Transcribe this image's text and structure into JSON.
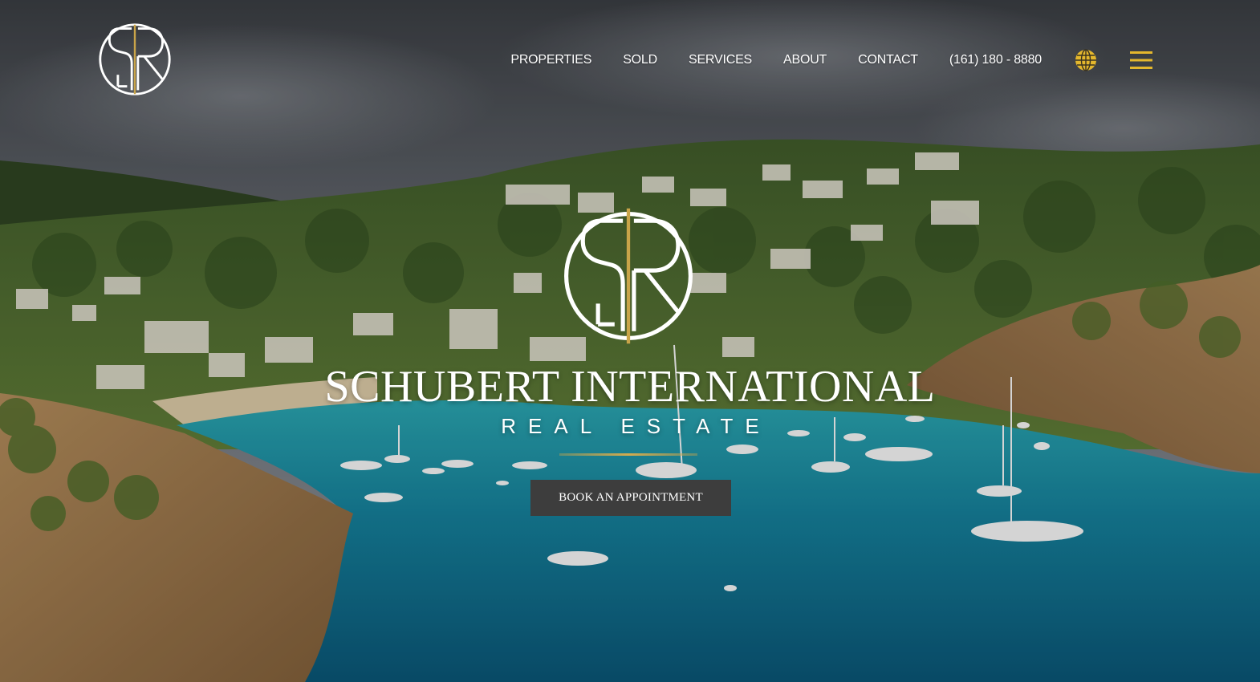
{
  "header": {
    "logo_alt": "SR",
    "nav": [
      {
        "label": "PROPERTIES"
      },
      {
        "label": "SOLD"
      },
      {
        "label": "SERVICES"
      },
      {
        "label": "ABOUT"
      },
      {
        "label": "CONTACT"
      },
      {
        "label": "(161) 180 - 8880"
      }
    ],
    "globe_icon": "globe-icon",
    "menu_icon": "hamburger-menu-icon"
  },
  "hero": {
    "brand_name": "SCHUBERT INTERNATIONAL",
    "brand_sub": "REAL ESTATE",
    "cta_label": "BOOK AN APPOINTMENT"
  },
  "colors": {
    "accent_gold": "#e4b72d",
    "logo_gold": "#c9a449",
    "button_bg": "#3d3d3d",
    "text": "#ffffff"
  }
}
